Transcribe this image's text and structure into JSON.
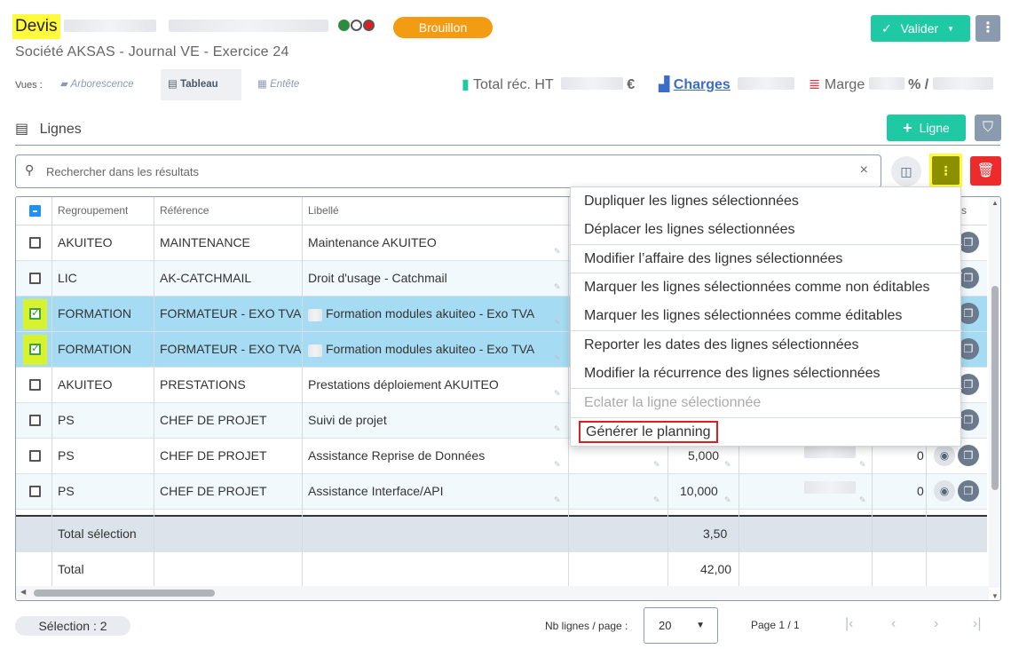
{
  "header": {
    "title": "Devis",
    "status": "Brouillon",
    "validate_label": "Valider",
    "validate_caret": "▼",
    "more_label": "⋮",
    "subtitle": "Société AKSAS  -  Journal VE  -  Exercice 24",
    "status_dots": [
      "#2e8b3e",
      "#ffffff",
      "#e01e1e"
    ]
  },
  "views": {
    "label": "Vues :",
    "tabs": [
      {
        "label": "Arborescence",
        "icon": "tree-icon"
      },
      {
        "label": "Tableau",
        "icon": "table-icon",
        "active": true
      },
      {
        "label": "Entête",
        "icon": "header-icon"
      }
    ]
  },
  "kpis": {
    "total_label": "Total réc. HT",
    "total_unit": "€",
    "charges_label": "Charges",
    "marge_label": "Marge",
    "marge_unit": "% /"
  },
  "section": {
    "title": "Lignes",
    "add_label": "Ligne"
  },
  "search": {
    "placeholder": "Rechercher dans les résultats",
    "clear": "×"
  },
  "table": {
    "headers": [
      "Regroupement",
      "Référence",
      "Libellé",
      "s"
    ],
    "rows": [
      {
        "group": "AKUITEO",
        "ref": "MAINTENANCE",
        "label": "Maintenance AKUITEO",
        "checked": false,
        "qty": "",
        "extra": ""
      },
      {
        "group": "LIC",
        "ref": "AK-CATCHMAIL",
        "label": "Droit d'usage - Catchmail",
        "checked": false,
        "qty": "",
        "extra": ""
      },
      {
        "group": "FORMATION",
        "ref": "FORMATEUR - EXO TVA",
        "label": "Formation modules akuiteo - Exo TVA",
        "checked": true,
        "qty": "",
        "extra": ""
      },
      {
        "group": "FORMATION",
        "ref": "FORMATEUR - EXO TVA",
        "label": "Formation modules akuiteo - Exo TVA",
        "checked": true,
        "qty": "",
        "extra": ""
      },
      {
        "group": "AKUITEO",
        "ref": "PRESTATIONS",
        "label": "Prestations déploiement AKUITEO",
        "checked": false,
        "qty": "",
        "extra": ""
      },
      {
        "group": "PS",
        "ref": "CHEF DE PROJET",
        "label": "Suivi de projet",
        "checked": false,
        "qty": "",
        "extra": ""
      },
      {
        "group": "PS",
        "ref": "CHEF DE PROJET",
        "label": "Assistance Reprise de Données",
        "checked": false,
        "qty": "5,000",
        "extra": "0"
      },
      {
        "group": "PS",
        "ref": "CHEF DE PROJET",
        "label": "Assistance Interface/API",
        "checked": false,
        "qty": "10,000",
        "extra": "0"
      }
    ],
    "total_selection_label": "Total sélection",
    "total_selection_value": "3,50",
    "total_label": "Total",
    "total_value": "42,00"
  },
  "menu": {
    "items": [
      {
        "label": "Dupliquer les lignes sélectionnées"
      },
      {
        "label": "Déplacer les lignes sélectionnées"
      },
      {
        "label": "Modifier l’affaire des lignes sélectionnées"
      },
      {
        "label": "Marquer les lignes sélectionnées comme non éditables"
      },
      {
        "label": "Marquer les lignes sélectionnées comme éditables"
      },
      {
        "label": "Reporter les dates des lignes sélectionnées"
      },
      {
        "label": "Modifier la récurrence des lignes sélectionnées"
      },
      {
        "label": "Eclater la ligne sélectionnée",
        "disabled": true
      },
      {
        "label": "Générer le planning",
        "highlighted": true
      }
    ]
  },
  "footer": {
    "selection": "Sélection : 2",
    "per_page_label": "Nb lignes / page :",
    "per_page_value": "20",
    "page_info": "Page 1 / 1"
  }
}
